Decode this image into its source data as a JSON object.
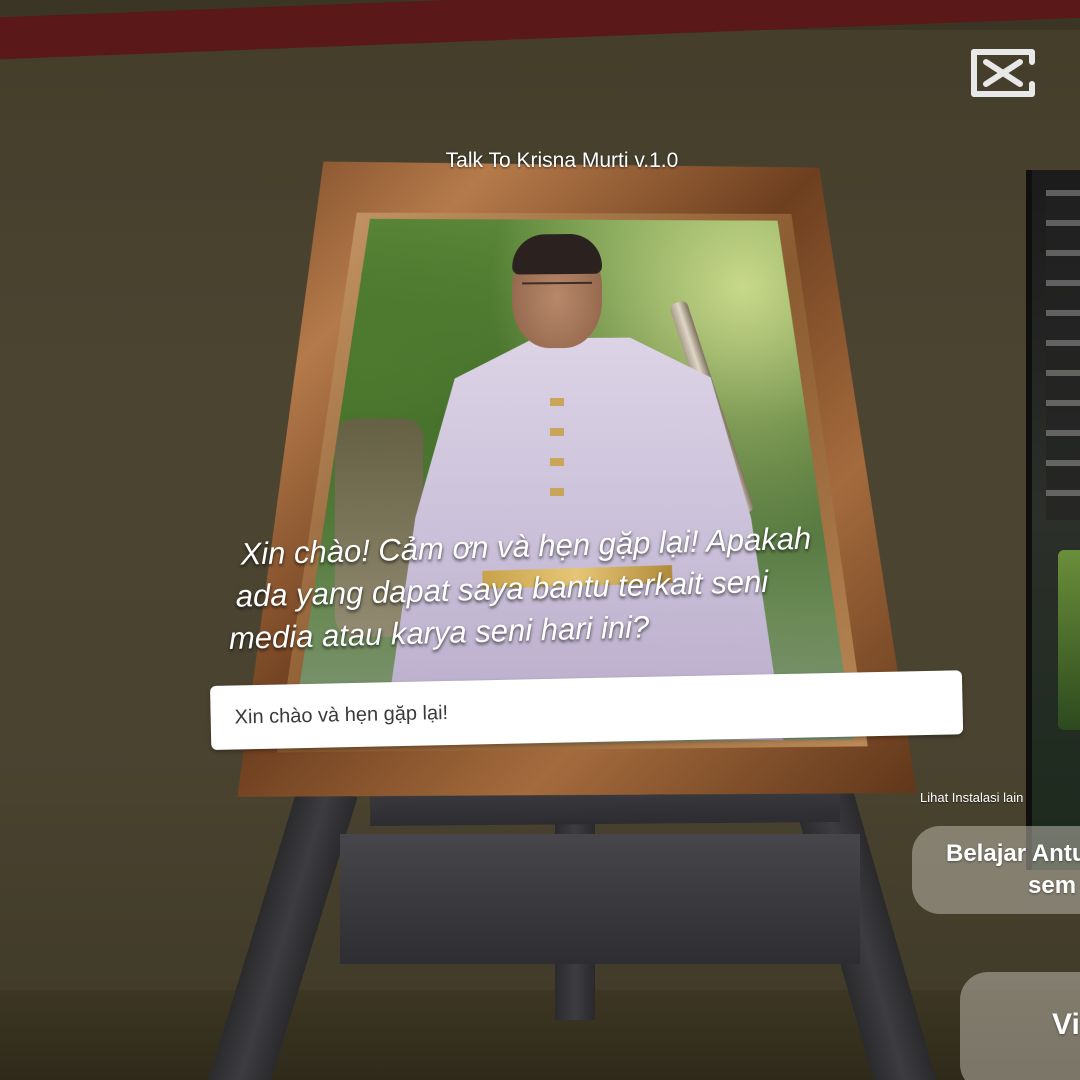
{
  "app": {
    "title": "Talk To Krisna Murti v.1.0"
  },
  "watermark": {
    "icon": "capcut-logo-icon"
  },
  "dialogue": {
    "lines": [
      "Xin chào! Cảm ơn và hẹn gặp lại! Apakah",
      "ada yang dapat saya bantu terkait seni",
      "media atau karya seni hari ini?"
    ]
  },
  "chat": {
    "input_value": "Xin chào và hẹn gặp lại!"
  },
  "side_panel": {
    "label": "Lihat Instalasi lain",
    "buttons": [
      {
        "line1": "Belajar Antu",
        "line2": "sem"
      },
      {
        "line1": "Vi"
      }
    ]
  },
  "colors": {
    "wall": "#4a4330",
    "trim": "#5a1818",
    "frame": "#8a5a30",
    "input_bg": "#ffffff",
    "button_bg": "#b9b4aa"
  }
}
